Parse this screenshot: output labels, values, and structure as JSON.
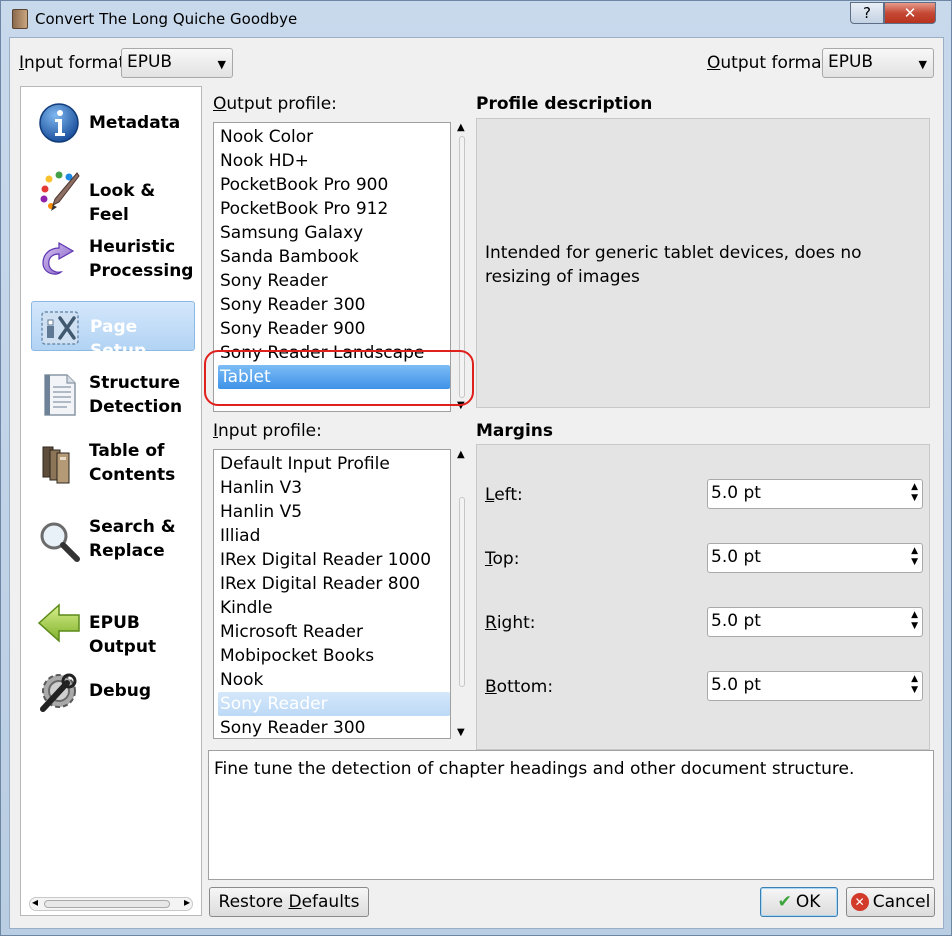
{
  "window": {
    "title": "Convert The Long Quiche Goodbye",
    "help_button": "?",
    "close_button": "✕"
  },
  "formats": {
    "input_label_u": "I",
    "input_label_rest": "nput format:",
    "input_value": "EPUB",
    "output_label_u": "O",
    "output_label_rest": "utput format:",
    "output_value": "EPUB"
  },
  "sidebar": {
    "items": [
      {
        "label": "Metadata",
        "icon": "info-icon"
      },
      {
        "label": "Look & Feel",
        "icon": "palette-icon"
      },
      {
        "label": "Heuristic Processing",
        "icon": "redo-arrow-icon"
      },
      {
        "label": "Page Setup",
        "icon": "page-setup-icon",
        "selected": true
      },
      {
        "label": "Structure Detection",
        "icon": "document-icon"
      },
      {
        "label": "Table of Contents",
        "icon": "books-icon"
      },
      {
        "label": "Search & Replace",
        "icon": "magnifier-icon"
      },
      {
        "label": "EPUB Output",
        "icon": "left-arrow-icon"
      },
      {
        "label": "Debug",
        "icon": "gear-wrench-icon"
      }
    ]
  },
  "output_profile": {
    "label_u": "O",
    "label_rest": "utput profile:",
    "items": [
      "Nook Color",
      "Nook HD+",
      "PocketBook Pro 900",
      "PocketBook Pro 912",
      "Samsung Galaxy",
      "Sanda Bambook",
      "Sony Reader",
      "Sony Reader 300",
      "Sony Reader 900",
      "Sony Reader Landscape",
      "Tablet"
    ],
    "selected": "Tablet"
  },
  "input_profile": {
    "label_u": "I",
    "label_rest": "nput profile:",
    "items": [
      "Default Input Profile",
      "Hanlin V3",
      "Hanlin V5",
      "Illiad",
      "IRex Digital Reader 1000",
      "IRex Digital Reader 800",
      "Kindle",
      "Microsoft Reader",
      "Mobipocket Books",
      "Nook",
      "Sony Reader",
      "Sony Reader 300"
    ],
    "selected": "Sony Reader"
  },
  "profile_description": {
    "title": "Profile description",
    "text": "Intended for generic tablet devices, does no resizing of images"
  },
  "margins": {
    "title": "Margins",
    "fields": [
      {
        "label_u": "L",
        "label_rest": "eft:",
        "value": "5.0 pt"
      },
      {
        "label_u": "T",
        "label_rest": "op:",
        "value": "5.0 pt"
      },
      {
        "label_u": "R",
        "label_rest": "ight:",
        "value": "5.0 pt"
      },
      {
        "label_u": "B",
        "label_rest": "ottom:",
        "value": "5.0 pt"
      }
    ]
  },
  "help": {
    "text": "Fine tune the detection of chapter headings and other document structure."
  },
  "buttons": {
    "restore_pre": "Restore ",
    "restore_u": "D",
    "restore_rest": "efaults",
    "ok": "OK",
    "cancel": "Cancel"
  }
}
